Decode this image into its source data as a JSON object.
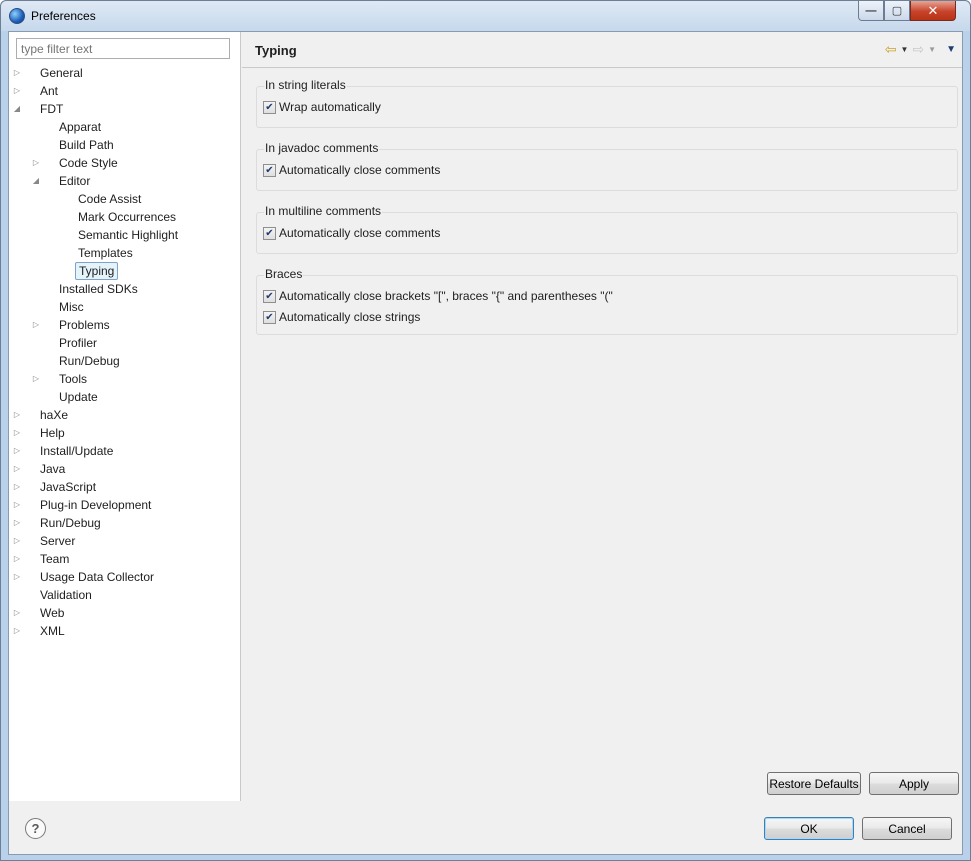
{
  "window": {
    "title": "Preferences"
  },
  "filter": {
    "placeholder": "type filter text",
    "value": ""
  },
  "tree": [
    {
      "label": "General",
      "level": 0,
      "arrow": "collapsed"
    },
    {
      "label": "Ant",
      "level": 0,
      "arrow": "collapsed"
    },
    {
      "label": "FDT",
      "level": 0,
      "arrow": "expanded"
    },
    {
      "label": "Apparat",
      "level": 1,
      "arrow": "none"
    },
    {
      "label": "Build Path",
      "level": 1,
      "arrow": "none"
    },
    {
      "label": "Code Style",
      "level": 1,
      "arrow": "collapsed"
    },
    {
      "label": "Editor",
      "level": 1,
      "arrow": "expanded"
    },
    {
      "label": "Code Assist",
      "level": 2,
      "arrow": "none"
    },
    {
      "label": "Mark Occurrences",
      "level": 2,
      "arrow": "none"
    },
    {
      "label": "Semantic Highlight",
      "level": 2,
      "arrow": "none"
    },
    {
      "label": "Templates",
      "level": 2,
      "arrow": "none"
    },
    {
      "label": "Typing",
      "level": 2,
      "arrow": "none",
      "selected": true
    },
    {
      "label": "Installed SDKs",
      "level": 1,
      "arrow": "none"
    },
    {
      "label": "Misc",
      "level": 1,
      "arrow": "none"
    },
    {
      "label": "Problems",
      "level": 1,
      "arrow": "collapsed"
    },
    {
      "label": "Profiler",
      "level": 1,
      "arrow": "none"
    },
    {
      "label": "Run/Debug",
      "level": 1,
      "arrow": "none"
    },
    {
      "label": "Tools",
      "level": 1,
      "arrow": "collapsed"
    },
    {
      "label": "Update",
      "level": 1,
      "arrow": "none"
    },
    {
      "label": "haXe",
      "level": 0,
      "arrow": "collapsed"
    },
    {
      "label": "Help",
      "level": 0,
      "arrow": "collapsed"
    },
    {
      "label": "Install/Update",
      "level": 0,
      "arrow": "collapsed"
    },
    {
      "label": "Java",
      "level": 0,
      "arrow": "collapsed"
    },
    {
      "label": "JavaScript",
      "level": 0,
      "arrow": "collapsed"
    },
    {
      "label": "Plug-in Development",
      "level": 0,
      "arrow": "collapsed"
    },
    {
      "label": "Run/Debug",
      "level": 0,
      "arrow": "collapsed"
    },
    {
      "label": "Server",
      "level": 0,
      "arrow": "collapsed"
    },
    {
      "label": "Team",
      "level": 0,
      "arrow": "collapsed"
    },
    {
      "label": "Usage Data Collector",
      "level": 0,
      "arrow": "collapsed"
    },
    {
      "label": "Validation",
      "level": 0,
      "arrow": "none"
    },
    {
      "label": "Web",
      "level": 0,
      "arrow": "collapsed"
    },
    {
      "label": "XML",
      "level": 0,
      "arrow": "collapsed"
    }
  ],
  "page": {
    "title": "Typing",
    "groups": [
      {
        "title": "In string literals",
        "options": [
          {
            "label": "Wrap automatically",
            "checked": true
          }
        ]
      },
      {
        "title": "In javadoc comments",
        "options": [
          {
            "label": "Automatically close comments",
            "checked": true
          }
        ]
      },
      {
        "title": "In multiline comments",
        "options": [
          {
            "label": "Automatically close comments",
            "checked": true
          }
        ]
      },
      {
        "title": "Braces",
        "options": [
          {
            "label": "Automatically close brackets \"[\", braces \"{\" and parentheses \"(\"",
            "checked": true
          },
          {
            "label": "Automatically close strings",
            "checked": true
          }
        ]
      }
    ]
  },
  "buttons": {
    "restore_defaults": "Restore Defaults",
    "apply": "Apply",
    "ok": "OK",
    "cancel": "Cancel"
  },
  "icons": {
    "back": "arrow-back-icon",
    "forward": "arrow-forward-icon",
    "help": "help-icon"
  }
}
